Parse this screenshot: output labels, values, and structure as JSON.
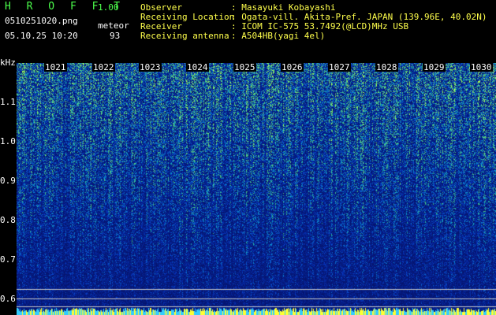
{
  "header": {
    "app_title": "H R O F F T",
    "version": "1.00",
    "filename": "0510251020.png",
    "datetime": "05.10.25 10:20",
    "mode_label": "meteor",
    "count": "93"
  },
  "station": {
    "observer_label": "Observer",
    "observer_value": ": Masayuki Kobayashi",
    "location_label": "Receiving Location",
    "location_value": ": Ogata-vill. Akita-Pref. JAPAN (139.96E, 40.02N)",
    "receiver_label": "Receiver",
    "receiver_value": ": ICOM IC-575 53.7492(@LCD)MHz USB",
    "antenna_label": "Receiving antenna",
    "antenna_value": ": A504HB(yagi 4el)"
  },
  "y_axis": {
    "unit": "kHz",
    "ticks": [
      "1.1",
      "1.0",
      "0.9",
      "0.8",
      "0.7",
      "0.6"
    ]
  },
  "x_axis": {
    "ticks": [
      "1021",
      "1022",
      "1023",
      "1024",
      "1025",
      "1026",
      "1027",
      "1028",
      "1029",
      "1030"
    ]
  },
  "colors": {
    "header_green": "#4cff4c",
    "header_yellow": "#ffff4c",
    "background": "#000000",
    "spectro_low": "#0a1f8f",
    "spectro_high": "#46d68c"
  }
}
